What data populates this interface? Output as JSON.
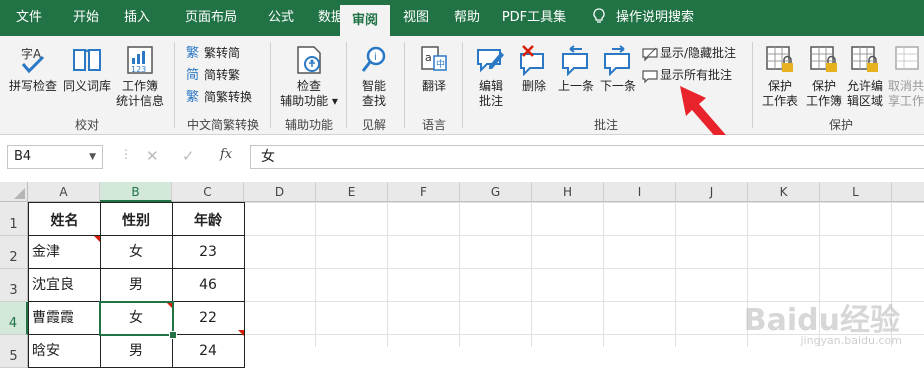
{
  "colors": {
    "excel_green": "#217346",
    "ribbon_bg": "#f3f3f3",
    "comment_red": "#d81e06",
    "arrow_red": "#e8232b"
  },
  "tabs": [
    "文件",
    "开始",
    "插入",
    "页面布局",
    "公式",
    "数据",
    "审阅",
    "视图",
    "帮助",
    "PDF工具集"
  ],
  "active_tab": "审阅",
  "tell_me": "操作说明搜索",
  "ribbon": {
    "proofing": {
      "spell": "拼写检查",
      "thesaurus": "同义词库",
      "stats1": "工作簿",
      "stats2": "统计信息",
      "label": "校对"
    },
    "chinese": {
      "t2s": "繁转简",
      "s2t": "简转繁",
      "convert": "简繁转换",
      "label": "中文简繁转换"
    },
    "access": {
      "btn1": "检查",
      "btn2": "辅助功能",
      "label": "辅助功能"
    },
    "insights": {
      "btn1": "智能",
      "btn2": "查找",
      "label": "见解"
    },
    "language": {
      "btn": "翻译",
      "label": "语言"
    },
    "comments": {
      "edit1": "编辑",
      "edit2": "批注",
      "delete": "删除",
      "prev": "上一条",
      "next": "下一条",
      "show_hide": "显示/隐藏批注",
      "show_all": "显示所有批注",
      "label": "批注"
    },
    "protect": {
      "sheet1": "保护",
      "sheet2": "工作表",
      "wb1": "保护",
      "wb2": "工作簿",
      "allow1": "允许编",
      "allow2": "辑区域",
      "unshare1": "取消共",
      "unshare2": "享工作",
      "label": "保护"
    }
  },
  "formula_bar": {
    "name_box": "B4",
    "content": "女",
    "fx": "fx"
  },
  "columns": [
    "A",
    "B",
    "C",
    "D",
    "E",
    "F",
    "G",
    "H",
    "I",
    "J",
    "K",
    "L"
  ],
  "selected_column": "B",
  "rows": [
    "1",
    "2",
    "3",
    "4",
    "5"
  ],
  "selected_row": "4",
  "table": {
    "header": [
      "姓名",
      "性别",
      "年龄"
    ],
    "data": [
      [
        "金津",
        "女",
        "23"
      ],
      [
        "沈宜良",
        "男",
        "46"
      ],
      [
        "曹霞霞",
        "女",
        "22"
      ],
      [
        "晗安",
        "男",
        "24"
      ]
    ]
  },
  "watermark": {
    "main": "Baidu经验",
    "sub": "jingyan.baidu.com"
  }
}
